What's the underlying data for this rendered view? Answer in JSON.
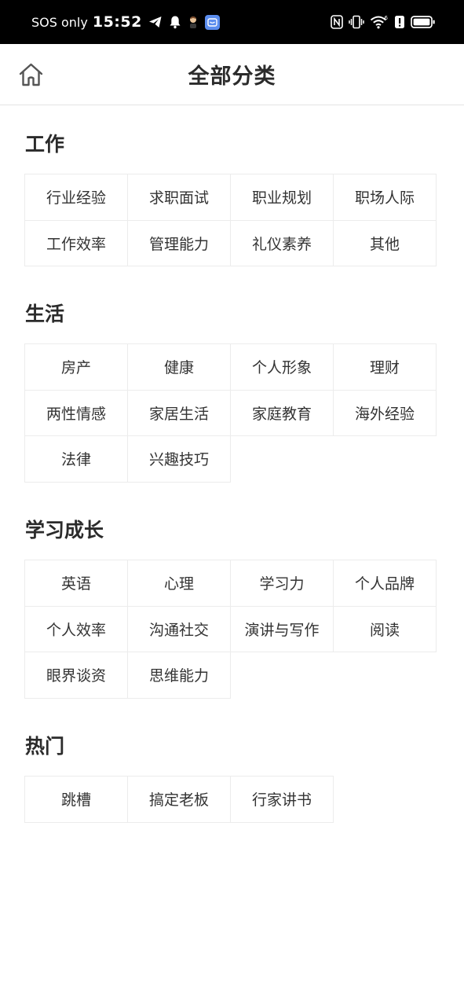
{
  "status_bar": {
    "carrier": "SOS only",
    "time": "15:52",
    "network_superscript": "6"
  },
  "header": {
    "title": "全部分类",
    "home_icon": "home-icon"
  },
  "sections": [
    {
      "title": "工作",
      "items": [
        "行业经验",
        "求职面试",
        "职业规划",
        "职场人际",
        "工作效率",
        "管理能力",
        "礼仪素养",
        "其他"
      ]
    },
    {
      "title": "生活",
      "items": [
        "房产",
        "健康",
        "个人形象",
        "理财",
        "两性情感",
        "家居生活",
        "家庭教育",
        "海外经验",
        "法律",
        "兴趣技巧"
      ]
    },
    {
      "title": "学习成长",
      "items": [
        "英语",
        "心理",
        "学习力",
        "个人品牌",
        "个人效率",
        "沟通社交",
        "演讲与写作",
        "阅读",
        "眼界谈资",
        "思维能力"
      ]
    },
    {
      "title": "热门",
      "items": [
        "跳槽",
        "搞定老板",
        "行家讲书"
      ]
    }
  ],
  "colors": {
    "status_bar_bg": "#000000",
    "text_primary": "#333333",
    "grid_border": "#ececec",
    "header_divider": "#e3e3e3"
  }
}
